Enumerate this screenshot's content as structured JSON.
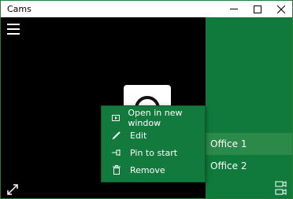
{
  "window": {
    "title": "Cams"
  },
  "controls": {
    "minimize_glyph": "—",
    "maximize_glyph": "☐",
    "close_glyph": "✕"
  },
  "context_menu": {
    "items": [
      {
        "label": "Open in new window",
        "icon": "open-window-icon"
      },
      {
        "label": "Edit",
        "icon": "pencil-icon"
      },
      {
        "label": "Pin to start",
        "icon": "pin-icon"
      },
      {
        "label": "Remove",
        "icon": "trash-icon"
      }
    ]
  },
  "cameras": [
    {
      "label": "Office 1",
      "selected": true
    },
    {
      "label": "Office 2",
      "selected": false
    }
  ],
  "colors": {
    "accent": "#0f7a3b",
    "accent_hover": "#2b8a4a",
    "background": "#000000"
  }
}
